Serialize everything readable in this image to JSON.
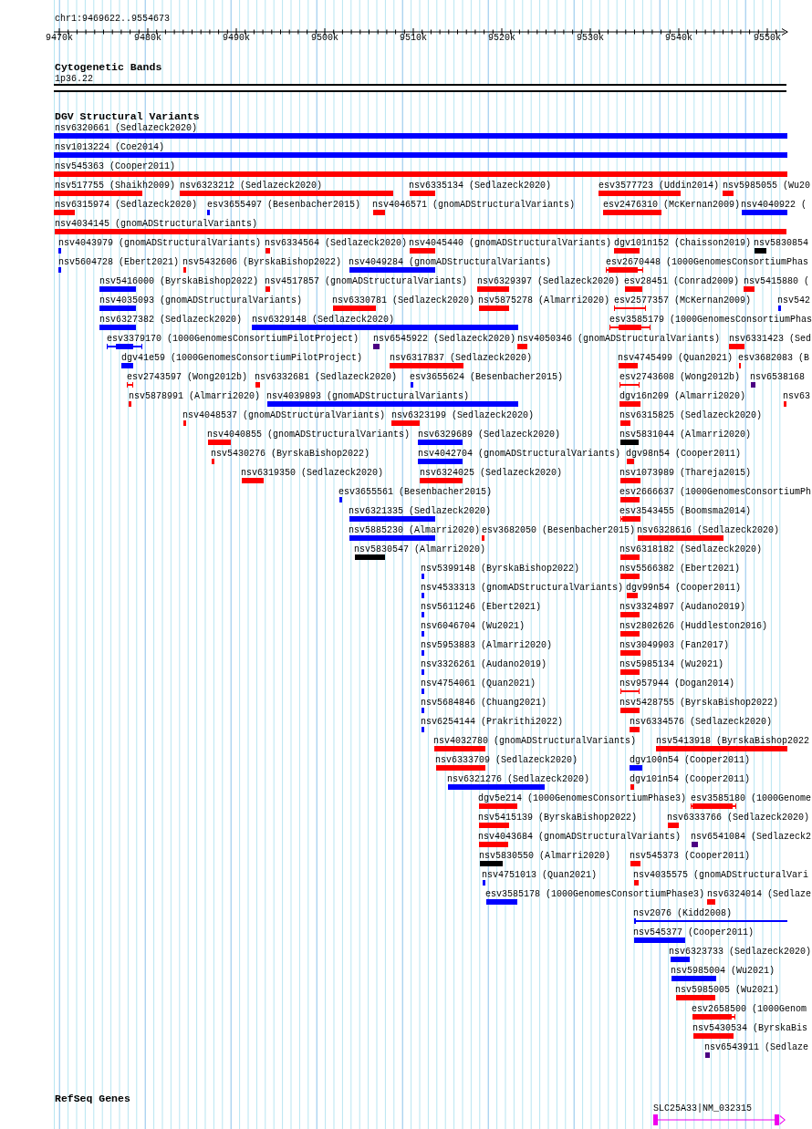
{
  "ruler": {
    "position": "chr1:9469622..9554673",
    "ticks": [
      "9470k",
      "9480k",
      "9490k",
      "9500k",
      "9510k",
      "9520k",
      "9530k",
      "9540k",
      "9550k"
    ]
  },
  "cytoband_track": {
    "title": "Cytogenetic Bands",
    "band": "1p36.22"
  },
  "dgv_track": {
    "title": "DGV Structural Variants",
    "rows": [
      {
        "features": [
          {
            "label": "nsv6320661 (Sedlazeck2020)",
            "color": "#0000ff",
            "kind": "block"
          }
        ]
      },
      {
        "features": [
          {
            "label": "nsv1013224 (Coe2014)",
            "color": "#0000ff",
            "kind": "block"
          }
        ]
      },
      {
        "features": [
          {
            "label": "nsv545363 (Cooper2011)",
            "color": "#ff0000",
            "kind": "block"
          }
        ]
      },
      {
        "features": [
          {
            "label": "nsv517755 (Shaikh2009)",
            "color": "#ff0000",
            "kind": "block"
          },
          {
            "label": "nsv6323212 (Sedlazeck2020)",
            "color": "#ff0000",
            "kind": "block"
          },
          {
            "label": "nsv6335134 (Sedlazeck2020)",
            "color": "#ff0000",
            "kind": "block"
          },
          {
            "label": "esv3577723 (Uddin2014)",
            "color": "#ff0000",
            "kind": "block"
          },
          {
            "label": "nsv5985055 (Wu20",
            "color": "#ff0000",
            "kind": "block"
          }
        ]
      },
      {
        "features": [
          {
            "label": "nsv6315974 (Sedlazeck2020)",
            "color": "#ff0000",
            "kind": "block"
          },
          {
            "label": "esv3655497 (Besenbacher2015)",
            "color": "#0000ff",
            "kind": "block"
          },
          {
            "label": "nsv4046571 (gnomADStructuralVariants)",
            "color": "#ff0000",
            "kind": "block"
          },
          {
            "label": "esv2476310 (McKernan2009)",
            "color": "#ff0000",
            "kind": "block"
          },
          {
            "label": "nsv4040922 (",
            "color": "#0000ff",
            "kind": "block"
          }
        ]
      },
      {
        "features": [
          {
            "label": "nsv4034145 (gnomADStructuralVariants)",
            "color": "#ff0000",
            "kind": "block"
          }
        ]
      },
      {
        "features": [
          {
            "label": "nsv4043979 (gnomADStructuralVariants)",
            "color": "#0000ff",
            "kind": "block"
          },
          {
            "label": "nsv6334564 (Sedlazeck2020)",
            "color": "#ff0000",
            "kind": "block"
          },
          {
            "label": "nsv4045440 (gnomADStructuralVariants)",
            "color": "#ff0000",
            "kind": "block"
          },
          {
            "label": "dgv101n152 (Chaisson2019)",
            "color": "#ff0000",
            "kind": "block"
          },
          {
            "label": "nsv5830854",
            "color": "#000000",
            "kind": "block"
          }
        ]
      },
      {
        "features": [
          {
            "label": "nsv5604728 (Ebert2021)",
            "color": "#0000ff",
            "kind": "block"
          },
          {
            "label": "nsv5432606 (ByrskaBishop2022)",
            "color": "#ff0000",
            "kind": "block"
          },
          {
            "label": "nsv4049284 (gnomADStructuralVariants)",
            "color": "#0000ff",
            "kind": "block"
          },
          {
            "label": "esv2670448 (1000GenomesConsortiumPhas",
            "color": "#ff0000",
            "kind": "range"
          }
        ]
      },
      {
        "features": [
          {
            "label": "nsv5416000 (ByrskaBishop2022)",
            "color": "#0000ff",
            "kind": "block"
          },
          {
            "label": "nsv4517857 (gnomADStructuralVariants)",
            "color": "#ff0000",
            "kind": "block"
          },
          {
            "label": "nsv6329397 (Sedlazeck2020)",
            "color": "#ff0000",
            "kind": "block"
          },
          {
            "label": "esv28451 (Conrad2009)",
            "color": "#ff0000",
            "kind": "block"
          },
          {
            "label": "nsv5415880 (",
            "color": "#ff0000",
            "kind": "block"
          }
        ]
      },
      {
        "features": [
          {
            "label": "nsv4035093 (gnomADStructuralVariants)",
            "color": "#0000ff",
            "kind": "block"
          },
          {
            "label": "nsv6330781 (Sedlazeck2020)",
            "color": "#ff0000",
            "kind": "block"
          },
          {
            "label": "nsv5875278 (Almarri2020)",
            "color": "#ff0000",
            "kind": "block"
          },
          {
            "label": "esv2577357 (McKernan2009)",
            "color": "#ff0000",
            "kind": "range"
          },
          {
            "label": "nsv542",
            "color": "#0000ff",
            "kind": "block"
          }
        ]
      },
      {
        "features": [
          {
            "label": "nsv6327382 (Sedlazeck2020)",
            "color": "#0000ff",
            "kind": "block"
          },
          {
            "label": "nsv6329148 (Sedlazeck2020)",
            "color": "#0000ff",
            "kind": "block"
          },
          {
            "label": "esv3585179 (1000GenomesConsortiumPhas",
            "color": "#ff0000",
            "kind": "range"
          }
        ]
      },
      {
        "features": [
          {
            "label": "esv3379170 (1000GenomesConsortiumPilotProject)",
            "color": "#0000ff",
            "kind": "range"
          },
          {
            "label": "nsv6545922 (Sedlazeck2020)",
            "color": "#4b0082",
            "kind": "block"
          },
          {
            "label": "nsv4050346 (gnomADStructuralVariants)",
            "color": "#ff0000",
            "kind": "block"
          },
          {
            "label": "nsv6331423 (Sed",
            "color": "#ff0000",
            "kind": "block"
          }
        ]
      },
      {
        "features": [
          {
            "label": "dgv41e59 (1000GenomesConsortiumPilotProject)",
            "color": "#0000ff",
            "kind": "block"
          },
          {
            "label": "nsv6317837 (Sedlazeck2020)",
            "color": "#ff0000",
            "kind": "block"
          },
          {
            "label": "nsv4745499 (Quan2021)",
            "color": "#ff0000",
            "kind": "block"
          },
          {
            "label": "esv3682083 (B",
            "color": "#ff0000",
            "kind": "block"
          }
        ]
      },
      {
        "features": [
          {
            "label": "esv2743597 (Wong2012b)",
            "color": "#ff0000",
            "kind": "range"
          },
          {
            "label": "nsv6332681 (Sedlazeck2020)",
            "color": "#ff0000",
            "kind": "block"
          },
          {
            "label": "esv3655624 (Besenbacher2015)",
            "color": "#0000ff",
            "kind": "block"
          },
          {
            "label": "esv2743608 (Wong2012b)",
            "color": "#ff0000",
            "kind": "range"
          },
          {
            "label": "nsv6538168",
            "color": "#4b0082",
            "kind": "block"
          }
        ]
      },
      {
        "features": [
          {
            "label": "nsv5878991 (Almarri2020)",
            "color": "#ff0000",
            "kind": "block"
          },
          {
            "label": "nsv4039893 (gnomADStructuralVariants)",
            "color": "#0000ff",
            "kind": "block"
          },
          {
            "label": "dgv16n209 (Almarri2020)",
            "color": "#ff0000",
            "kind": "block"
          },
          {
            "label": "nsv63",
            "color": "#ff0000",
            "kind": "block"
          }
        ]
      },
      {
        "features": [
          {
            "label": "nsv4048537 (gnomADStructuralVariants)",
            "color": "#ff0000",
            "kind": "block"
          },
          {
            "label": "nsv6323199 (Sedlazeck2020)",
            "color": "#ff0000",
            "kind": "block"
          },
          {
            "label": "nsv6315825 (Sedlazeck2020)",
            "color": "#ff0000",
            "kind": "block"
          }
        ]
      },
      {
        "features": [
          {
            "label": "nsv4040855 (gnomADStructuralVariants)",
            "color": "#ff0000",
            "kind": "block"
          },
          {
            "label": "nsv6329689 (Sedlazeck2020)",
            "color": "#0000ff",
            "kind": "block"
          },
          {
            "label": "nsv5831044 (Almarri2020)",
            "color": "#000000",
            "kind": "block"
          }
        ]
      },
      {
        "features": [
          {
            "label": "nsv5430276 (ByrskaBishop2022)",
            "color": "#ff0000",
            "kind": "block"
          },
          {
            "label": "nsv4042704 (gnomADStructuralVariants)",
            "color": "#0000ff",
            "kind": "block"
          },
          {
            "label": "dgv98n54 (Cooper2011)",
            "color": "#ff0000",
            "kind": "block"
          }
        ]
      },
      {
        "features": [
          {
            "label": "nsv6319350 (Sedlazeck2020)",
            "color": "#ff0000",
            "kind": "block"
          },
          {
            "label": "nsv6324025 (Sedlazeck2020)",
            "color": "#ff0000",
            "kind": "block"
          },
          {
            "label": "nsv1073989 (Thareja2015)",
            "color": "#ff0000",
            "kind": "block"
          }
        ]
      },
      {
        "features": [
          {
            "label": "esv3655561 (Besenbacher2015)",
            "color": "#0000ff",
            "kind": "block"
          },
          {
            "label": "esv2666637 (1000GenomesConsortiumPh",
            "color": "#ff0000",
            "kind": "block"
          }
        ]
      },
      {
        "features": [
          {
            "label": "nsv6321335 (Sedlazeck2020)",
            "color": "#0000ff",
            "kind": "block"
          },
          {
            "label": "esv3543455 (Boomsma2014)",
            "color": "#ff0000",
            "kind": "range"
          }
        ]
      },
      {
        "features": [
          {
            "label": "nsv5885230 (Almarri2020)",
            "color": "#0000ff",
            "kind": "block"
          },
          {
            "label": "esv3682050 (Besenbacher2015)",
            "color": "#ff0000",
            "kind": "block"
          },
          {
            "label": "nsv6328616 (Sedlazeck2020)",
            "color": "#ff0000",
            "kind": "block"
          }
        ]
      },
      {
        "features": [
          {
            "label": "nsv5830547 (Almarri2020)",
            "color": "#000000",
            "kind": "block"
          },
          {
            "label": "nsv6318182 (Sedlazeck2020)",
            "color": "#ff0000",
            "kind": "block"
          }
        ]
      },
      {
        "features": [
          {
            "label": "nsv5399148 (ByrskaBishop2022)",
            "color": "#0000ff",
            "kind": "block"
          },
          {
            "label": "nsv5566382 (Ebert2021)",
            "color": "#ff0000",
            "kind": "block"
          }
        ]
      },
      {
        "features": [
          {
            "label": "nsv4533313 (gnomADStructuralVariants)",
            "color": "#0000ff",
            "kind": "block"
          },
          {
            "label": "dgv99n54 (Cooper2011)",
            "color": "#ff0000",
            "kind": "block"
          }
        ]
      },
      {
        "features": [
          {
            "label": "nsv5611246 (Ebert2021)",
            "color": "#0000ff",
            "kind": "block"
          },
          {
            "label": "nsv3324897 (Audano2019)",
            "color": "#ff0000",
            "kind": "block"
          }
        ]
      },
      {
        "features": [
          {
            "label": "nsv6046704 (Wu2021)",
            "color": "#0000ff",
            "kind": "block"
          },
          {
            "label": "nsv2802626 (Huddleston2016)",
            "color": "#ff0000",
            "kind": "block"
          }
        ]
      },
      {
        "features": [
          {
            "label": "nsv5953883 (Almarri2020)",
            "color": "#0000ff",
            "kind": "block"
          },
          {
            "label": "nsv3049903 (Fan2017)",
            "color": "#ff0000",
            "kind": "block"
          }
        ]
      },
      {
        "features": [
          {
            "label": "nsv3326261 (Audano2019)",
            "color": "#0000ff",
            "kind": "block"
          },
          {
            "label": "nsv5985134 (Wu2021)",
            "color": "#ff0000",
            "kind": "block"
          }
        ]
      },
      {
        "features": [
          {
            "label": "nsv4754061 (Quan2021)",
            "color": "#0000ff",
            "kind": "block"
          },
          {
            "label": "nsv957944 (Dogan2014)",
            "color": "#ff0000",
            "kind": "range"
          }
        ]
      },
      {
        "features": [
          {
            "label": "nsv5684846 (Chuang2021)",
            "color": "#0000ff",
            "kind": "block"
          },
          {
            "label": "nsv5428755 (ByrskaBishop2022)",
            "color": "#ff0000",
            "kind": "block"
          }
        ]
      },
      {
        "features": [
          {
            "label": "nsv6254144 (Prakrithi2022)",
            "color": "#0000ff",
            "kind": "block"
          },
          {
            "label": "nsv6334576 (Sedlazeck2020)",
            "color": "#ff0000",
            "kind": "block"
          }
        ]
      },
      {
        "features": [
          {
            "label": "nsv4032780 (gnomADStructuralVariants)",
            "color": "#ff0000",
            "kind": "block"
          },
          {
            "label": "nsv5413918 (ByrskaBishop2022",
            "color": "#ff0000",
            "kind": "block"
          }
        ]
      },
      {
        "features": [
          {
            "label": "nsv6333709 (Sedlazeck2020)",
            "color": "#ff0000",
            "kind": "block"
          },
          {
            "label": "dgv100n54 (Cooper2011)",
            "color": "#0000ff",
            "kind": "block"
          }
        ]
      },
      {
        "features": [
          {
            "label": "nsv6321276 (Sedlazeck2020)",
            "color": "#0000ff",
            "kind": "block"
          },
          {
            "label": "dgv101n54 (Cooper2011)",
            "color": "#ff0000",
            "kind": "block"
          }
        ]
      },
      {
        "features": [
          {
            "label": "dgv5e214 (1000GenomesConsortiumPhase3)",
            "color": "#ff0000",
            "kind": "block"
          },
          {
            "label": "esv3585180 (1000Genome",
            "color": "#ff0000",
            "kind": "range"
          }
        ]
      },
      {
        "features": [
          {
            "label": "nsv5415139 (ByrskaBishop2022)",
            "color": "#ff0000",
            "kind": "block"
          },
          {
            "label": "nsv6333766 (Sedlazeck2020)",
            "color": "#ff0000",
            "kind": "block"
          }
        ]
      },
      {
        "features": [
          {
            "label": "nsv4043684 (gnomADStructuralVariants)",
            "color": "#ff0000",
            "kind": "block"
          },
          {
            "label": "nsv6541084 (Sedlazeck2",
            "color": "#4b0082",
            "kind": "block"
          }
        ]
      },
      {
        "features": [
          {
            "label": "nsv5830550 (Almarri2020)",
            "color": "#000000",
            "kind": "block"
          },
          {
            "label": "nsv545373 (Cooper2011)",
            "color": "#ff0000",
            "kind": "block"
          }
        ]
      },
      {
        "features": [
          {
            "label": "nsv4751013 (Quan2021)",
            "color": "#0000ff",
            "kind": "block"
          },
          {
            "label": "nsv4035575 (gnomADStructuralVari",
            "color": "#ff0000",
            "kind": "block"
          }
        ]
      },
      {
        "features": [
          {
            "label": "esv3585178 (1000GenomesConsortiumPhase3)",
            "color": "#0000ff",
            "kind": "block"
          },
          {
            "label": "nsv6324014 (Sedlaze",
            "color": "#ff0000",
            "kind": "block"
          }
        ]
      },
      {
        "features": [
          {
            "label": "nsv2076 (Kidd2008)",
            "color": "#0000ff",
            "kind": "line"
          }
        ]
      },
      {
        "features": [
          {
            "label": "nsv545377 (Cooper2011)",
            "color": "#0000ff",
            "kind": "block"
          }
        ]
      },
      {
        "features": [
          {
            "label": "nsv6323733 (Sedlazeck2020)",
            "color": "#0000ff",
            "kind": "block"
          }
        ]
      },
      {
        "features": [
          {
            "label": "nsv5985004 (Wu2021)",
            "color": "#0000ff",
            "kind": "block"
          }
        ]
      },
      {
        "features": [
          {
            "label": "nsv5985005 (Wu2021)",
            "color": "#ff0000",
            "kind": "block"
          }
        ]
      },
      {
        "features": [
          {
            "label": "esv2658500 (1000Genom",
            "color": "#ff0000",
            "kind": "range"
          }
        ]
      },
      {
        "features": [
          {
            "label": "nsv5430534 (ByrskaBis",
            "color": "#ff0000",
            "kind": "block"
          }
        ]
      },
      {
        "features": [
          {
            "label": "nsv6543911 (Sedlaze",
            "color": "#4b0082",
            "kind": "block"
          }
        ]
      }
    ]
  },
  "refseq_track": {
    "title": "RefSeq Genes",
    "genes": [
      {
        "label": "SLC25A33|NM_032315"
      }
    ]
  }
}
